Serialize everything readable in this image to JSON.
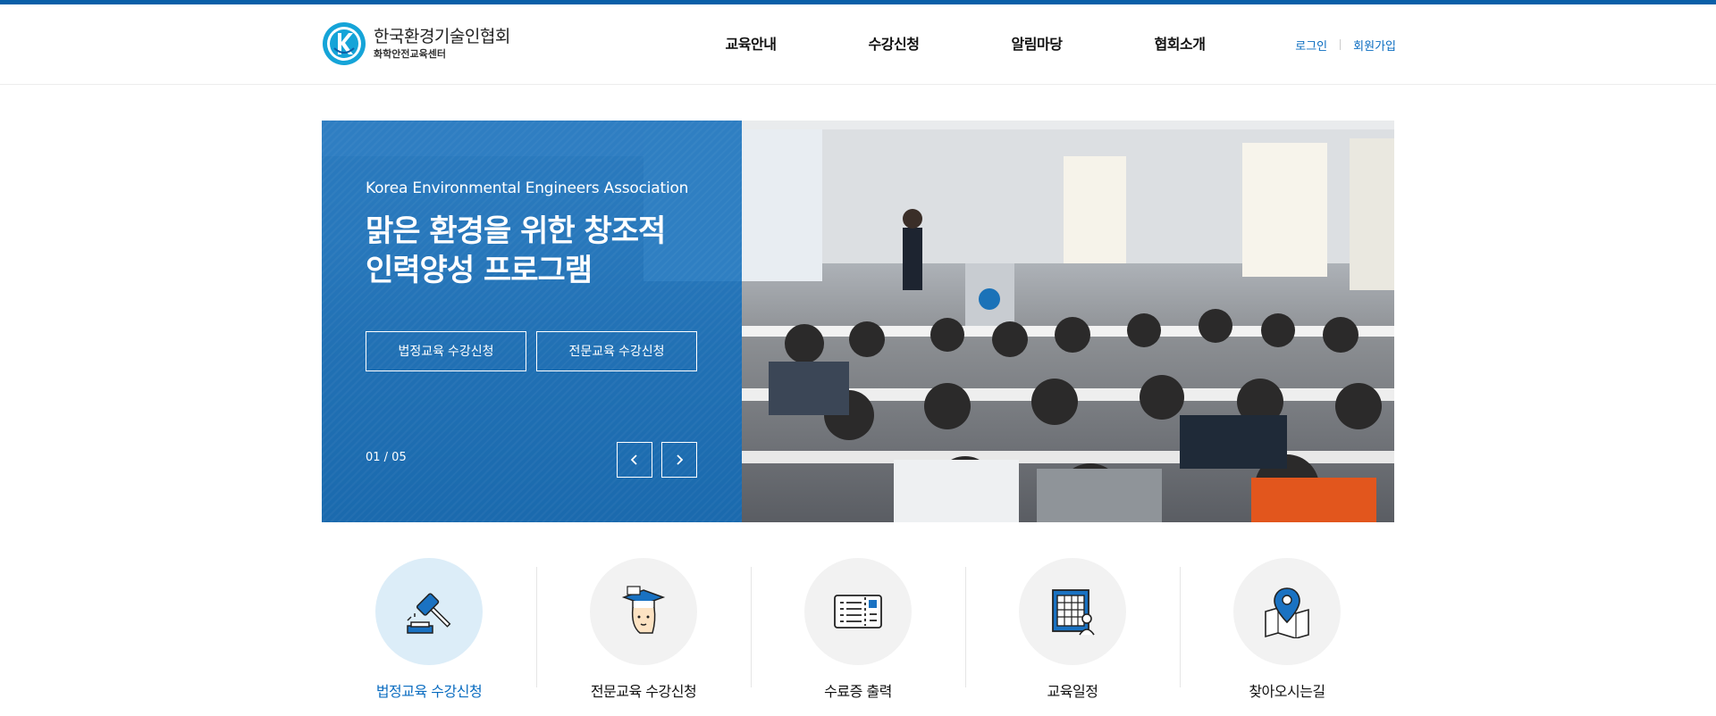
{
  "brand": {
    "title": "한국환경기술인협회",
    "subtitle": "화학안전교육센터",
    "color": "#0a5fa8"
  },
  "nav": {
    "items": [
      {
        "label": "교육안내"
      },
      {
        "label": "수강신청"
      },
      {
        "label": "알림마당"
      },
      {
        "label": "협회소개"
      }
    ]
  },
  "util": {
    "login": "로그인",
    "signup": "회원가입"
  },
  "hero": {
    "eyebrow": "Korea Environmental Engineers Association",
    "headline_line1": "맑은 환경을 위한 창조적",
    "headline_line2": "인력양성 프로그램",
    "buttons": [
      {
        "label": "법정교육 수강신청"
      },
      {
        "label": "전문교육 수강신청"
      }
    ],
    "counter": "01 / 05",
    "prev_icon": "chevron-left-icon",
    "next_icon": "chevron-right-icon",
    "panel_color": "#106cba"
  },
  "quick_links": [
    {
      "label": "법정교육 수강신청",
      "icon": "gavel-icon",
      "active": true
    },
    {
      "label": "전문교육 수강신청",
      "icon": "graduate-icon",
      "active": false
    },
    {
      "label": "수료증 출력",
      "icon": "certificate-icon",
      "active": false
    },
    {
      "label": "교육일정",
      "icon": "calendar-icon",
      "active": false
    },
    {
      "label": "찾아오시는길",
      "icon": "map-pin-icon",
      "active": false
    }
  ]
}
